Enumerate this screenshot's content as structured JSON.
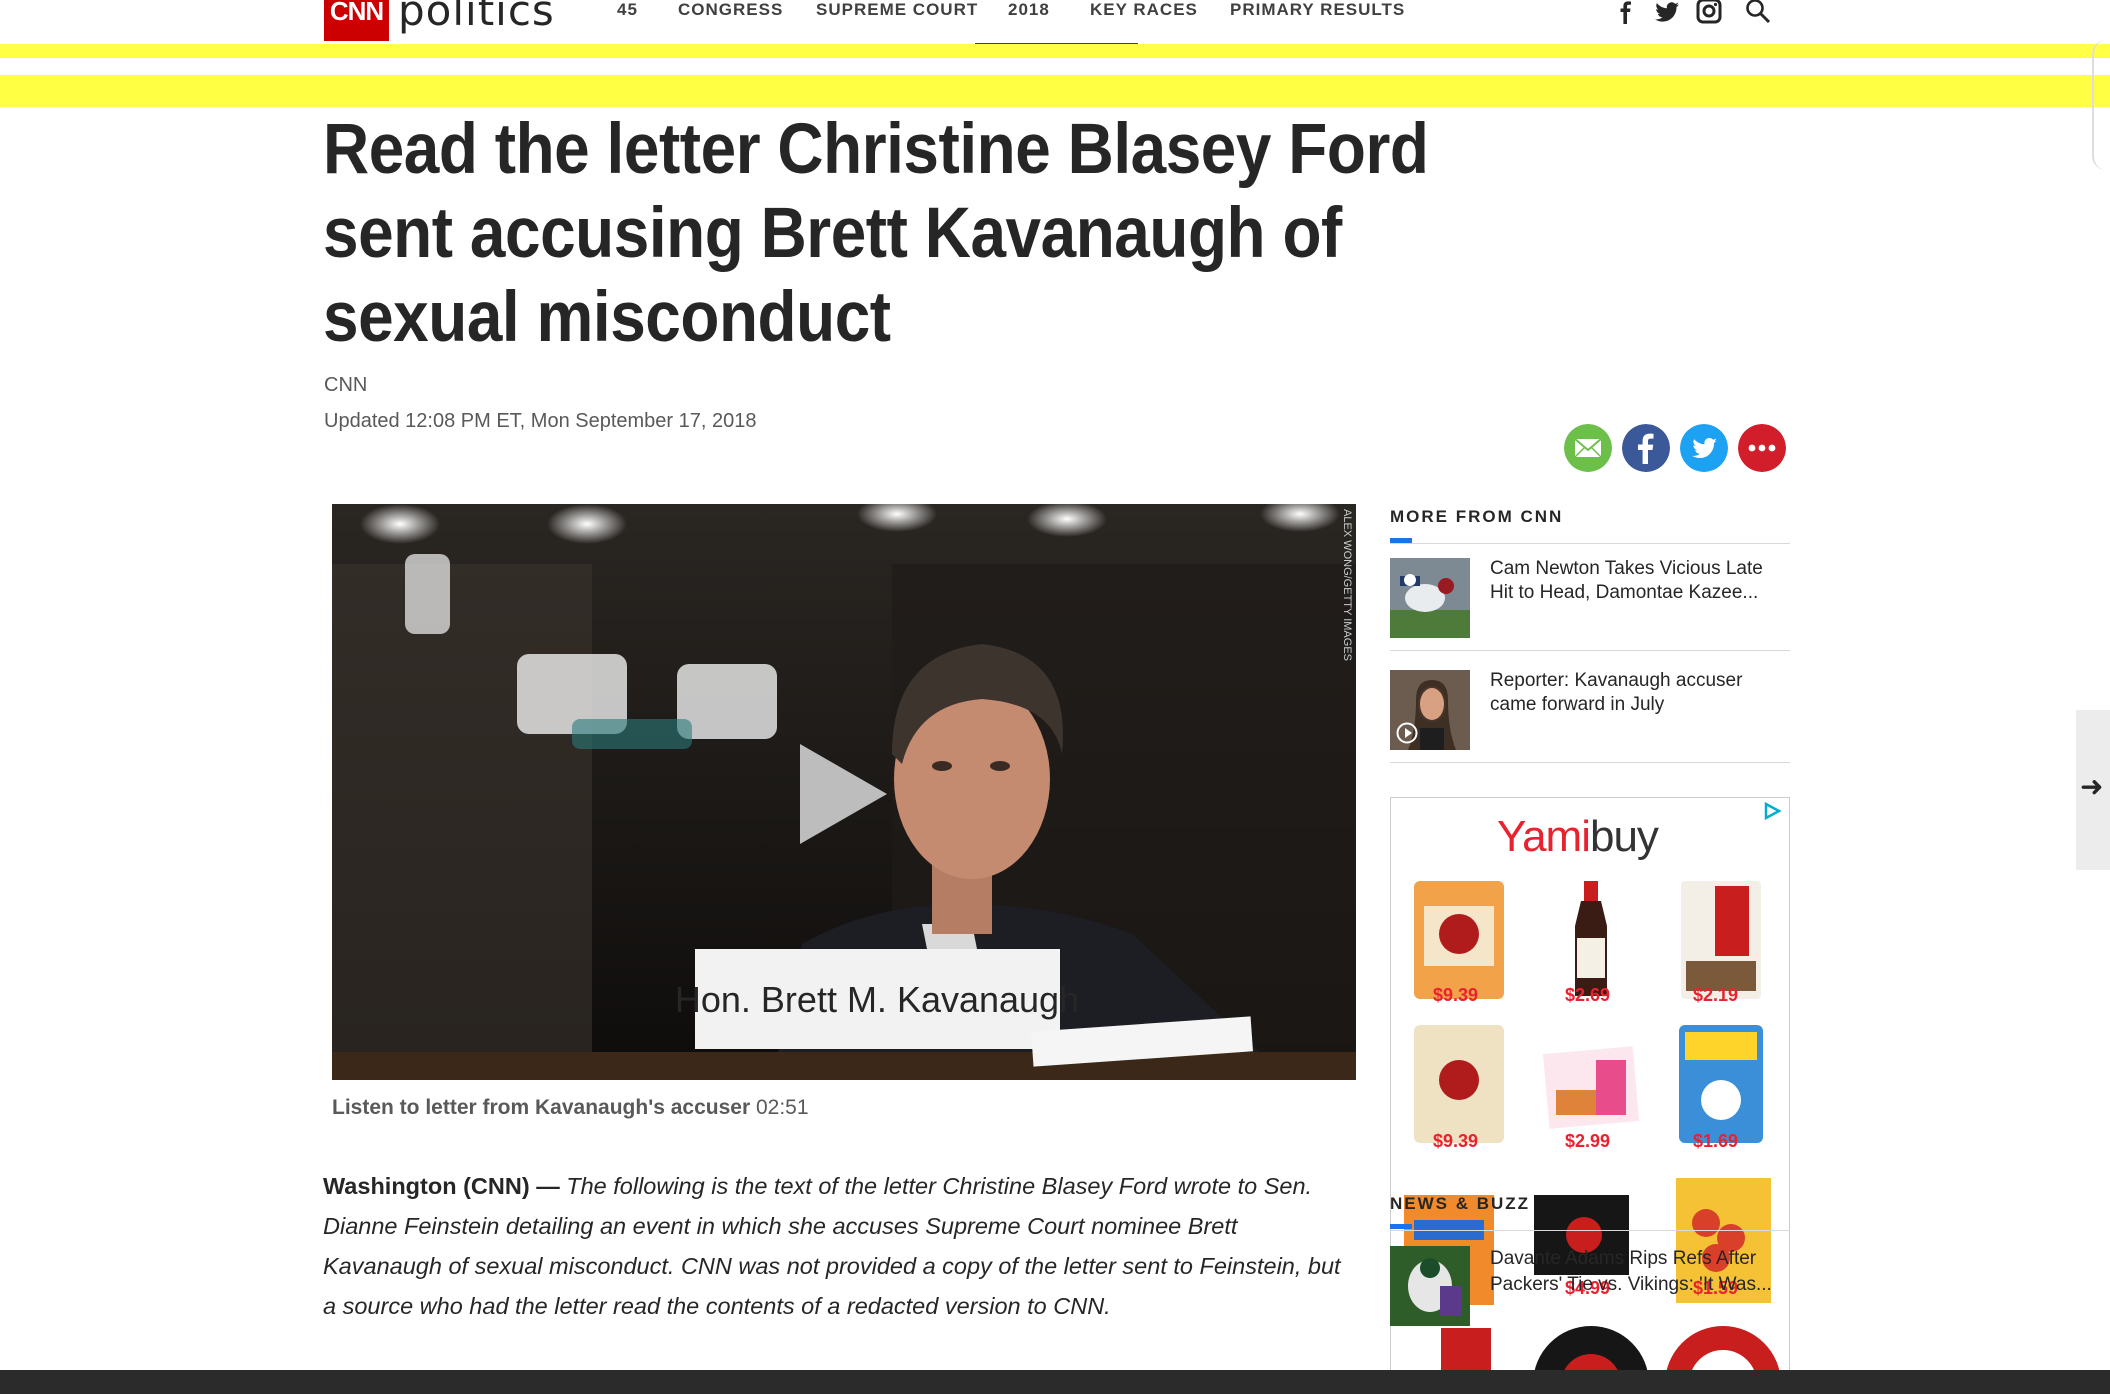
{
  "nav": {
    "logo_mark": "CNN",
    "logo_word": "politics",
    "items": [
      "45",
      "CONGRESS",
      "SUPREME COURT",
      "2018",
      "KEY RACES",
      "PRIMARY RESULTS"
    ],
    "icons": [
      "facebook-icon",
      "twitter-icon",
      "instagram-icon",
      "search-icon"
    ]
  },
  "article": {
    "headline": "Read the letter Christine Blasey Ford sent accusing Brett Kavanaugh of sexual misconduct",
    "byline": "CNN",
    "updated": "Updated 12:08 PM ET, Mon September 17, 2018",
    "share_icons": [
      "email-icon",
      "facebook-icon",
      "twitter-icon",
      "more-icon"
    ],
    "video": {
      "nameplate": "Hon. Brett M. Kavanaugh",
      "photo_credit": "ALEX WONG/GETTY IMAGES",
      "caption_title": "Listen to letter from Kavanaugh's accuser",
      "caption_duration": "02:51"
    },
    "dateline": "Washington (CNN) —",
    "lede": "The following is the text of the letter Christine Blasey Ford wrote to Sen. Dianne Feinstein detailing an event in which she accuses Supreme Court nominee Brett Kavanaugh of sexual misconduct. CNN was not provided a copy of the letter sent to Feinstein, but a source who had the letter read the contents of a redacted version to CNN."
  },
  "rail": {
    "title": "MORE FROM CNN",
    "items": [
      {
        "text": "Cam Newton Takes Vicious Late Hit to Head, Damontae Kazee..."
      },
      {
        "text": "Reporter: Kavanaugh accuser came forward in July"
      }
    ]
  },
  "ad": {
    "brand_red": "Yami",
    "brand_gray": "buy",
    "prices": [
      "$9.39",
      "$2.69",
      "$2.19",
      "$9.39",
      "$2.99",
      "$1.69",
      "$4.99",
      "$1.59"
    ]
  },
  "news_buzz": {
    "title": "NEWS & BUZZ",
    "text": "Davante Adams Rips Refs After Packers' Tie vs. Vikings: 'It Was..."
  },
  "colors": {
    "cnn_red": "#cc0000",
    "highlight_yellow": "#ffff44",
    "accent_blue": "#1a73e8",
    "price_red": "#e8222f"
  }
}
